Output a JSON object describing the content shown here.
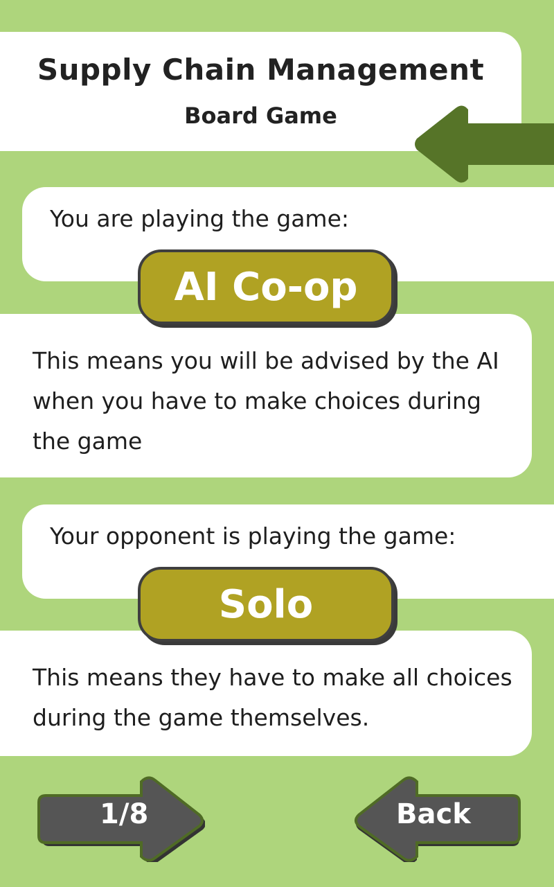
{
  "header": {
    "title": "Supply Chain Management",
    "subtitle": "Board Game"
  },
  "player": {
    "label": "You are playing the game:",
    "mode": "AI Co-op",
    "description": "This means you will be advised by the AI when you have to make choices during the game"
  },
  "opponent": {
    "label": "Your opponent is playing the game:",
    "mode": "Solo",
    "description": "This means they have to make all choices during the game themselves."
  },
  "navigation": {
    "page_indicator": "1/8",
    "back_label": "Back"
  },
  "colors": {
    "background": "#aed57c",
    "arrow_dark_green": "#567428",
    "badge": "#b0a223",
    "button": "#555555"
  },
  "icons": {
    "top_arrow": "left-arrow-icon"
  }
}
